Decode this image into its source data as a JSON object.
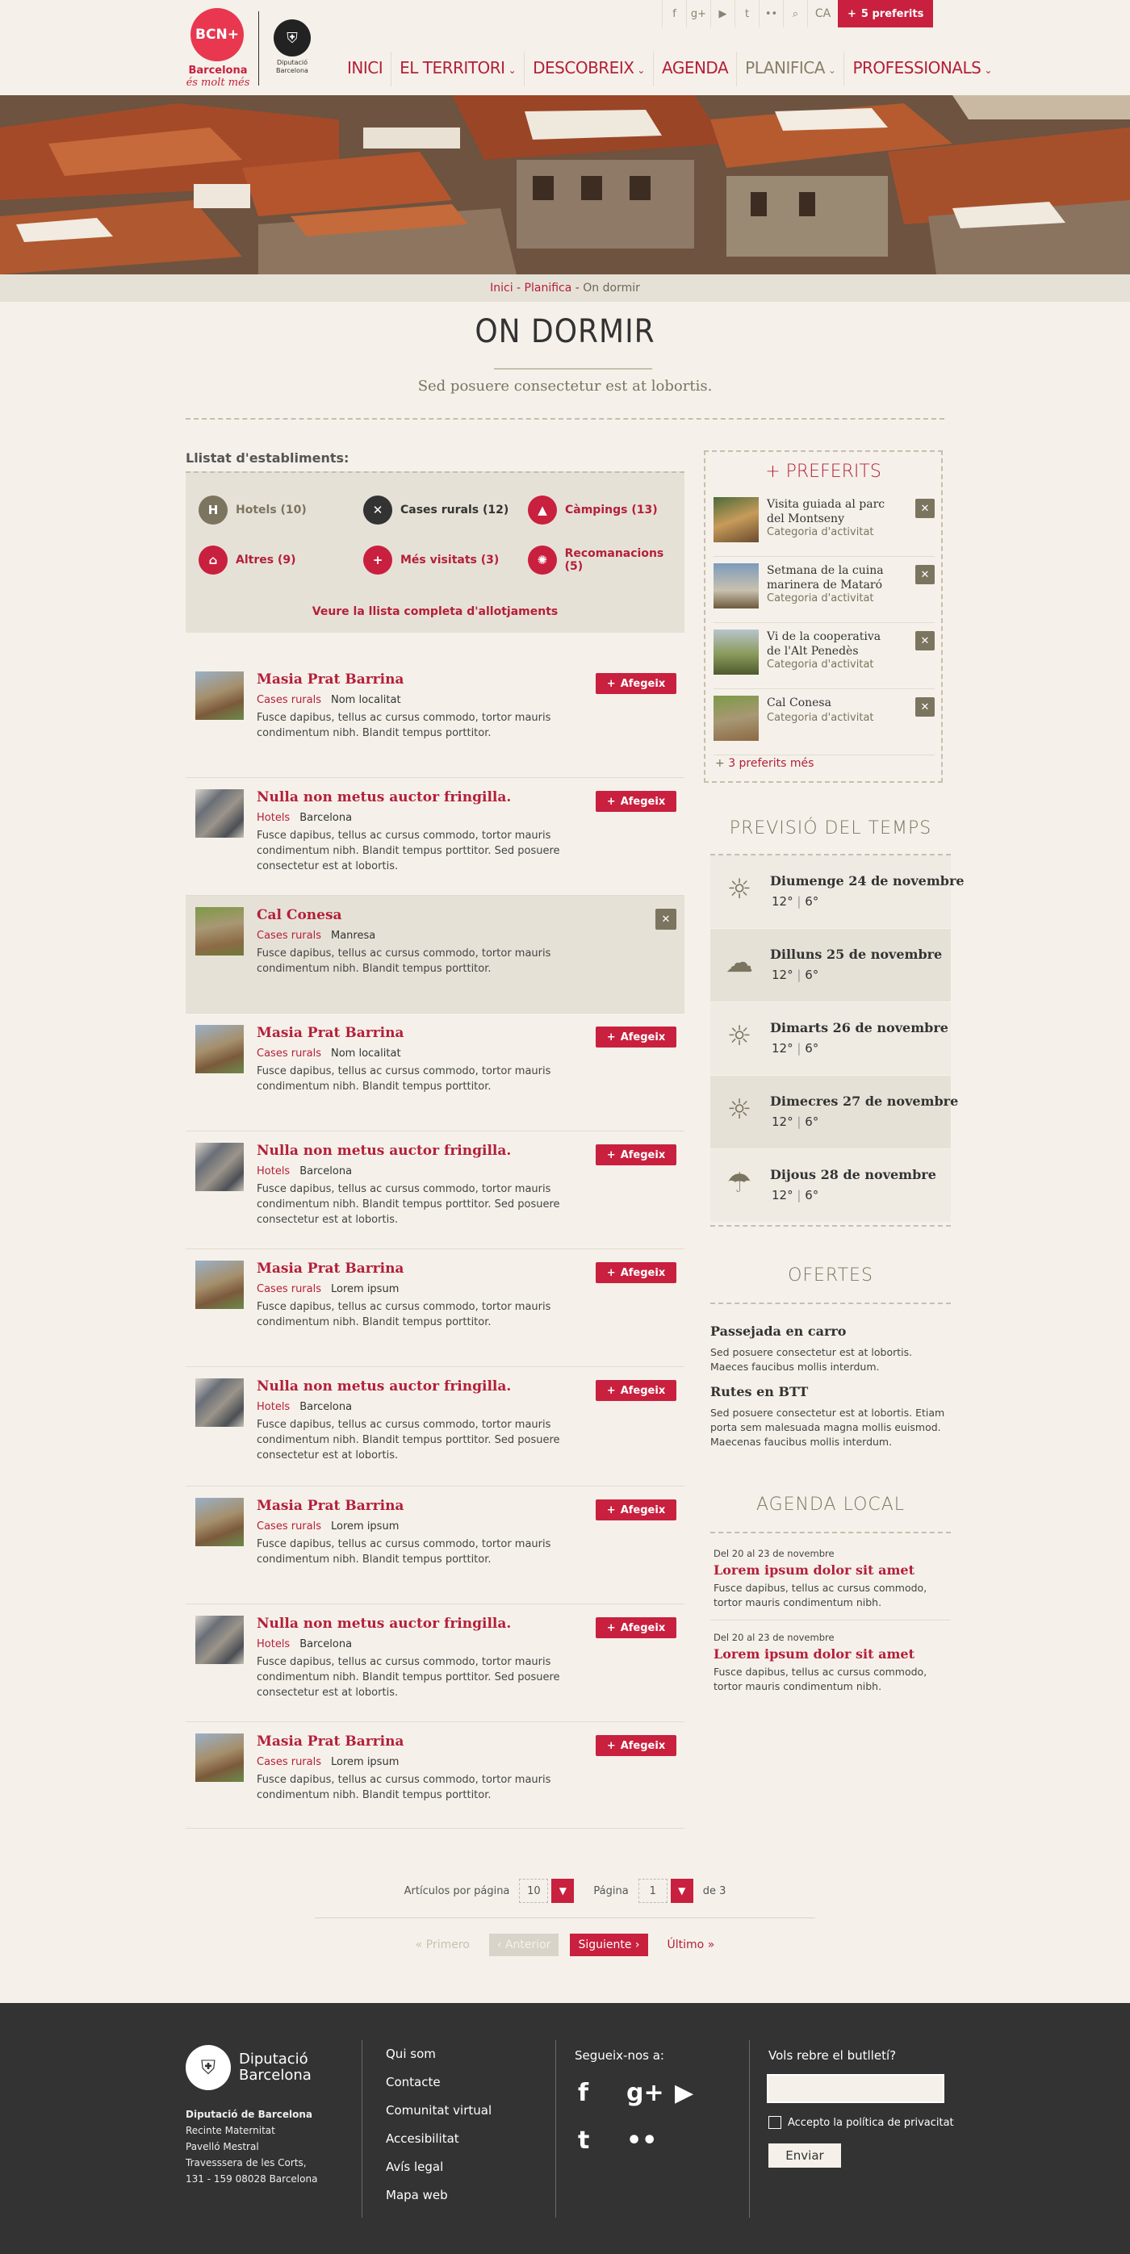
{
  "topbar": {
    "icons": [
      "facebook-icon",
      "googleplus-icon",
      "youtube-icon",
      "twitter-icon",
      "flickr-icon",
      "search-icon"
    ],
    "lang": "CA",
    "favorites": "5 preferits"
  },
  "brand": {
    "bcn_mark": "BCN",
    "bcn_line1": "Barcelona",
    "bcn_line2": "és molt més",
    "dip_line1": "Diputació",
    "dip_line2": "Barcelona"
  },
  "nav": {
    "items": [
      {
        "label": "INICI",
        "has_menu": false,
        "active": false
      },
      {
        "label": "EL TERRITORI",
        "has_menu": true,
        "active": false
      },
      {
        "label": "DESCOBREIX",
        "has_menu": true,
        "active": false
      },
      {
        "label": "AGENDA",
        "has_menu": false,
        "active": false
      },
      {
        "label": "PLANIFICA",
        "has_menu": true,
        "active": true
      },
      {
        "label": "PROFESSIONALS",
        "has_menu": true,
        "active": false
      }
    ]
  },
  "breadcrumb": {
    "items": [
      "Inici",
      "Planifica"
    ],
    "sep": " - ",
    "current": "On dormir"
  },
  "page": {
    "title": "ON DORMIR",
    "subtitle": "Sed posuere consectetur est at lobortis."
  },
  "list_header": "Llistat d'establiments:",
  "categories": [
    {
      "label": "Hotels (10)",
      "icon": "hotel-icon",
      "glyph": "H",
      "color": "#7b745f",
      "text_color": "#7b745f"
    },
    {
      "label": "Cases rurals (12)",
      "icon": "close-icon",
      "glyph": "✕",
      "color": "#333333",
      "text_color": "#333333"
    },
    {
      "label": "Càmpings (13)",
      "icon": "tent-icon",
      "glyph": "▲",
      "color": "#c8203e",
      "text_color": "#b41f39"
    },
    {
      "label": "Altres (9)",
      "icon": "house-icon",
      "glyph": "⌂",
      "color": "#c8203e",
      "text_color": "#b41f39"
    },
    {
      "label": "Més visitats (3)",
      "icon": "star-plus-icon",
      "glyph": "+",
      "color": "#c8203e",
      "text_color": "#b41f39"
    },
    {
      "label": "Recomanacions (5)",
      "icon": "sun-badge-icon",
      "glyph": "✺",
      "color": "#c8203e",
      "text_color": "#b41f39"
    }
  ],
  "view_all": "Veure la llista completa d'allotjaments",
  "add_label": "Afegeix",
  "listings": [
    {
      "title": "Masia Prat Barrina",
      "cat": "Cases rurals",
      "place": "Nom localitat",
      "desc": "Fusce dapibus, tellus ac cursus commodo, tortor mauris condimentum nibh. Blandit tempus porttitor.",
      "added": false,
      "thumb": "a"
    },
    {
      "title": "Nulla non metus auctor fringilla.",
      "cat": "Hotels",
      "place": "Barcelona",
      "desc": "Fusce dapibus, tellus ac cursus commodo, tortor mauris condimentum nibh. Blandit tempus porttitor. Sed posuere consectetur est at lobortis.",
      "added": false,
      "thumb": "b"
    },
    {
      "title": "Cal Conesa",
      "cat": "Cases rurals",
      "place": "Manresa",
      "desc": "Fusce dapibus, tellus ac cursus commodo, tortor mauris condimentum nibh. Blandit tempus porttitor.",
      "added": true,
      "thumb": "c"
    },
    {
      "title": "Masia Prat Barrina",
      "cat": "Cases rurals",
      "place": "Nom localitat",
      "desc": "Fusce dapibus, tellus ac cursus commodo, tortor mauris condimentum nibh. Blandit tempus porttitor.",
      "added": false,
      "thumb": "a"
    },
    {
      "title": "Nulla non metus auctor fringilla.",
      "cat": "Hotels",
      "place": "Barcelona",
      "desc": "Fusce dapibus, tellus ac cursus commodo, tortor mauris condimentum nibh. Blandit tempus porttitor. Sed posuere consectetur est at lobortis.",
      "added": false,
      "thumb": "b"
    },
    {
      "title": "Masia Prat Barrina",
      "cat": "Cases rurals",
      "place": "Lorem ipsum",
      "desc": "Fusce dapibus, tellus ac cursus commodo, tortor mauris condimentum nibh. Blandit tempus porttitor.",
      "added": false,
      "thumb": "a"
    },
    {
      "title": "Nulla non metus auctor fringilla.",
      "cat": "Hotels",
      "place": "Barcelona",
      "desc": "Fusce dapibus, tellus ac cursus commodo, tortor mauris condimentum nibh. Blandit tempus porttitor. Sed posuere consectetur est at lobortis.",
      "added": false,
      "thumb": "b"
    },
    {
      "title": "Masia Prat Barrina",
      "cat": "Cases rurals",
      "place": "Lorem ipsum",
      "desc": "Fusce dapibus, tellus ac cursus commodo, tortor mauris condimentum nibh. Blandit tempus porttitor.",
      "added": false,
      "thumb": "a"
    },
    {
      "title": "Nulla non metus auctor fringilla.",
      "cat": "Hotels",
      "place": "Barcelona",
      "desc": "Fusce dapibus, tellus ac cursus commodo, tortor mauris condimentum nibh. Blandit tempus porttitor. Sed posuere consectetur est at lobortis.",
      "added": false,
      "thumb": "b"
    },
    {
      "title": "Masia Prat Barrina",
      "cat": "Cases rurals",
      "place": "Lorem ipsum",
      "desc": "Fusce dapibus, tellus ac cursus commodo, tortor mauris condimentum nibh. Blandit tempus porttitor.",
      "added": false,
      "thumb": "a"
    }
  ],
  "favorites_box": {
    "title": "PREFERITS",
    "items": [
      {
        "title": "Visita guiada al parc del Montseny",
        "cat": "Categoria d'activitat"
      },
      {
        "title": "Setmana de la cuina marinera de Mataró",
        "cat": "Categoria d'activitat"
      },
      {
        "title": "Vi de la cooperativa de l'Alt Penedès",
        "cat": "Categoria d'activitat"
      },
      {
        "title": "Cal Conesa",
        "cat": "Categoria d'activitat"
      }
    ],
    "more": "3 preferits més"
  },
  "weather": {
    "title": "PREVISIÓ DEL TEMPS",
    "days": [
      {
        "day": "Diumenge 24 de novembre",
        "max": "12°",
        "min": "6°",
        "icon": "sun-icon",
        "glyph": "☼"
      },
      {
        "day": "Dilluns 25 de novembre",
        "max": "12°",
        "min": "6°",
        "icon": "cloud-sun-icon",
        "glyph": "☁"
      },
      {
        "day": "Dimarts 26 de novembre",
        "max": "12°",
        "min": "6°",
        "icon": "sun-icon",
        "glyph": "☼"
      },
      {
        "day": "Dimecres 27 de novembre",
        "max": "12°",
        "min": "6°",
        "icon": "sun-icon",
        "glyph": "☼"
      },
      {
        "day": "Dijous 28 de novembre",
        "max": "12°",
        "min": "6°",
        "icon": "rain-icon",
        "glyph": "☂"
      }
    ]
  },
  "offers": {
    "title": "OFERTES",
    "items": [
      {
        "title": "Passejada en carro",
        "desc": "Sed posuere consectetur est at lobortis. Maeces faucibus mollis interdum."
      },
      {
        "title": "Rutes en BTT",
        "desc": "Sed posuere consectetur est at lobortis. Etiam porta sem malesuada magna mollis euismod. Maecenas faucibus mollis interdum."
      }
    ]
  },
  "agenda": {
    "title": "AGENDA LOCAL",
    "items": [
      {
        "date": "Del 20 al 23 de novembre",
        "title": "Lorem ipsum dolor sit amet",
        "desc": "Fusce dapibus, tellus ac cursus commodo, tortor mauris condimentum nibh."
      },
      {
        "date": "Del 20 al 23 de novembre",
        "title": "Lorem ipsum dolor sit amet",
        "desc": "Fusce dapibus, tellus ac cursus commodo, tortor mauris condimentum nibh."
      }
    ]
  },
  "pagination": {
    "per_page_label": "Artículos por página",
    "per_page": "10",
    "page_label": "Página",
    "page": "1",
    "of": "de 3",
    "first": "Primero",
    "prev": "Anterior",
    "next": "Siguiente",
    "last": "Último"
  },
  "footer": {
    "org1": "Diputació",
    "org2": "Barcelona",
    "address_title": "Diputació de Barcelona",
    "address": [
      "Recinte Maternitat",
      "Pavelló Mestral",
      "Travesssera de les Corts,",
      "131 - 159 08028 Barcelona"
    ],
    "links": [
      "Qui som",
      "Contacte",
      "Comunitat virtual",
      "Accesibilitat",
      "Avís legal",
      "Mapa web"
    ],
    "follow": "Segueix-nos a:",
    "newsletter": "Vols rebre el butlletí?",
    "privacy": "Accepto la política de privacitat",
    "send": "Enviar"
  },
  "colors": {
    "accent": "#c8203e",
    "olive": "#7b745f",
    "bg": "#f5f1ea",
    "footer": "#333333"
  }
}
